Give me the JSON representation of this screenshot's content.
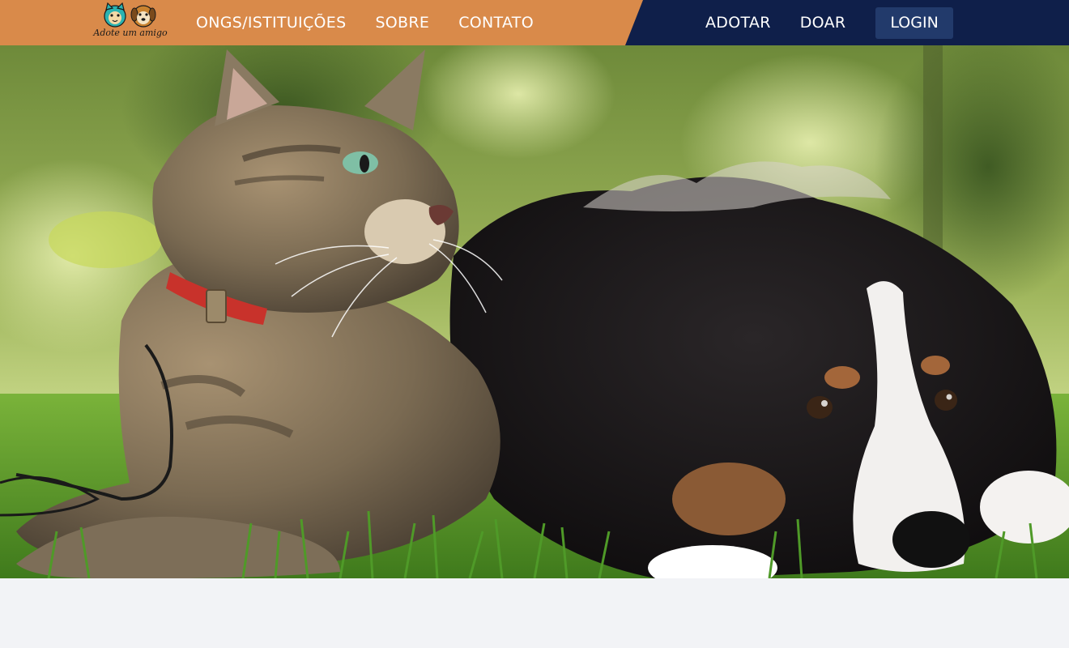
{
  "brand": {
    "logo_text": "Adote um amigo",
    "colors": {
      "orange": "#d98a4a",
      "navy": "#0f1f4a",
      "login_bg": "#223a6b"
    }
  },
  "nav": {
    "left": [
      {
        "label": "ONGS/ISTITUIÇÕES"
      },
      {
        "label": "SOBRE"
      },
      {
        "label": "CONTATO"
      }
    ],
    "right": [
      {
        "label": "ADOTAR"
      },
      {
        "label": "DOAR"
      }
    ],
    "login_label": "LOGIN"
  },
  "hero": {
    "image_subject": "cat-and-puppy-photo"
  }
}
